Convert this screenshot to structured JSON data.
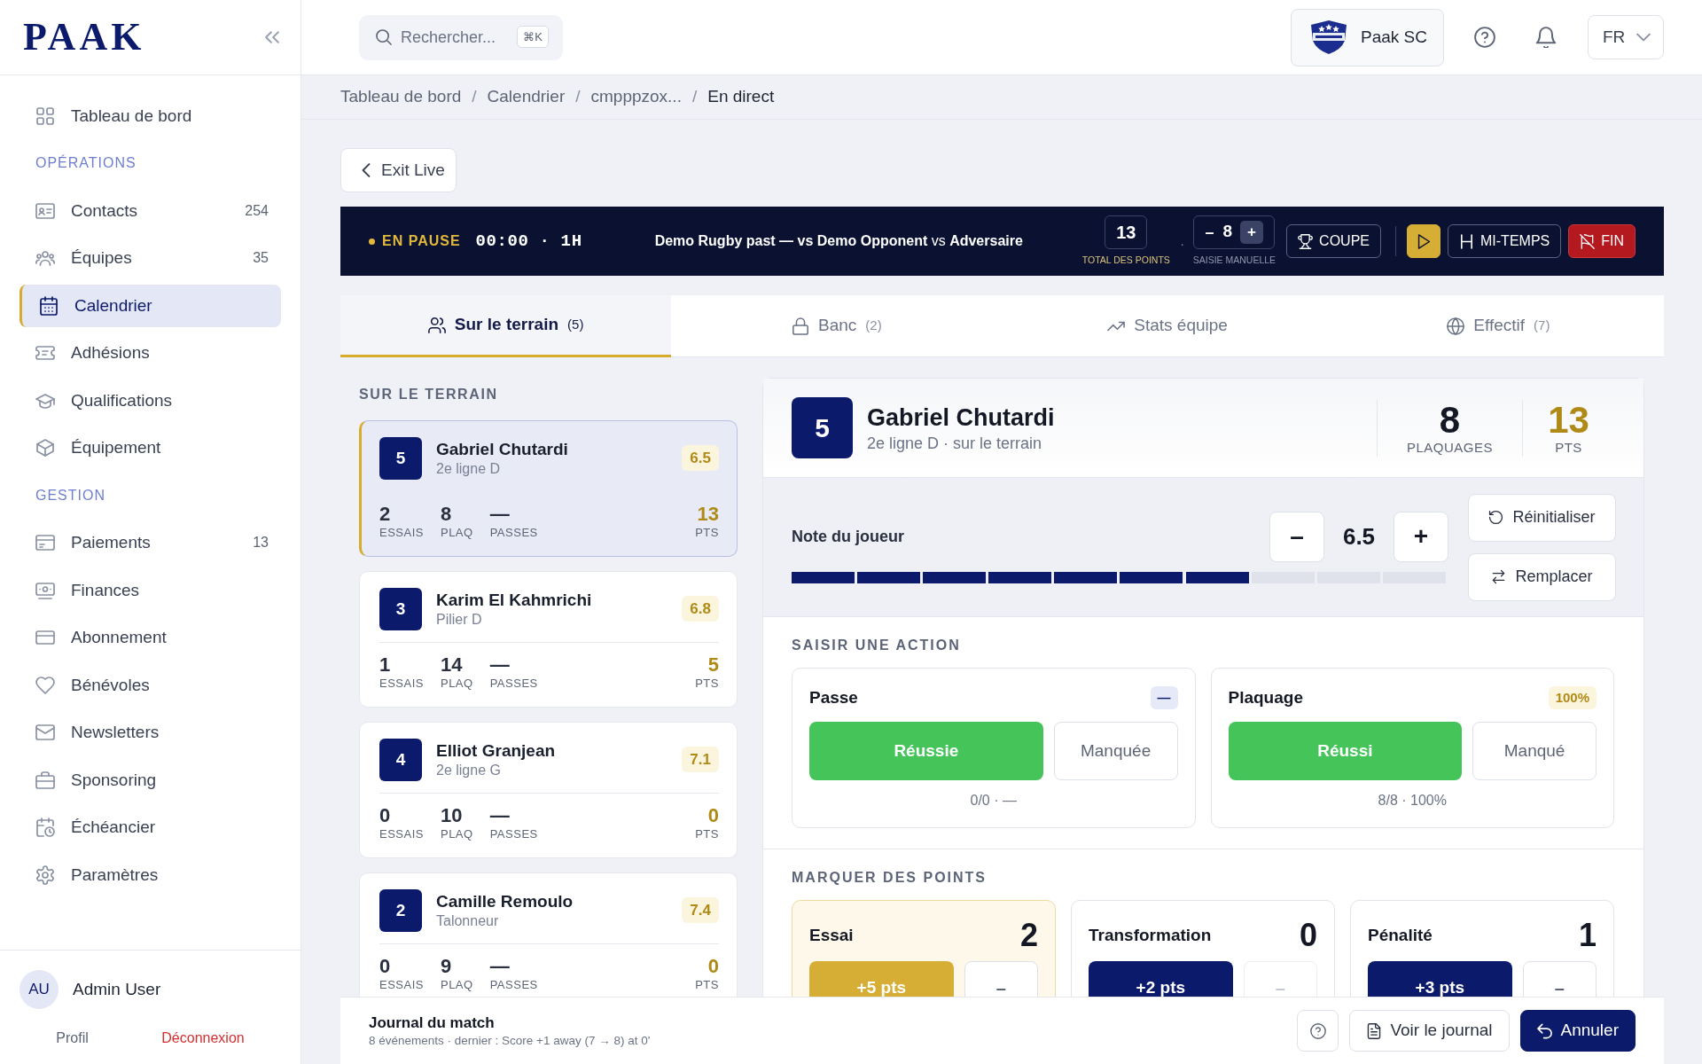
{
  "sidebar": {
    "logo": "PAAK",
    "home": {
      "label": "Tableau de bord",
      "selected": false
    },
    "sections": [
      {
        "title": "OPÉRATIONS",
        "items": [
          {
            "label": "Contacts",
            "count": "254",
            "selected": false
          },
          {
            "label": "Équipes",
            "count": "35",
            "selected": false
          },
          {
            "label": "Calendrier",
            "selected": true
          },
          {
            "label": "Adhésions",
            "selected": false
          },
          {
            "label": "Qualifications",
            "selected": false
          },
          {
            "label": "Équipement",
            "selected": false
          }
        ]
      },
      {
        "title": "GESTION",
        "items": [
          {
            "label": "Paiements",
            "count": "13",
            "selected": false
          },
          {
            "label": "Finances",
            "selected": false
          },
          {
            "label": "Abonnement",
            "selected": false
          },
          {
            "label": "Bénévoles",
            "selected": false
          },
          {
            "label": "Newsletters",
            "selected": false
          },
          {
            "label": "Sponsoring",
            "selected": false
          },
          {
            "label": "Échéancier",
            "selected": false
          },
          {
            "label": "Paramètres",
            "selected": false
          }
        ]
      }
    ],
    "user": {
      "initials": "AU",
      "name": "Admin User",
      "links": [
        {
          "label": "Profil",
          "kind": "plain"
        },
        {
          "label": "Déconnexion",
          "kind": "danger"
        }
      ]
    }
  },
  "topbar": {
    "search": {
      "placeholder": "Rechercher...",
      "shortcut": "⌘K"
    },
    "club": "Paak SC",
    "language": "FR"
  },
  "breadcrumb": [
    {
      "kind": "link",
      "label": "Tableau de bord"
    },
    {
      "kind": "separator",
      "label": "/"
    },
    {
      "kind": "link",
      "label": "Calendrier"
    },
    {
      "kind": "separator",
      "label": "/"
    },
    {
      "kind": "link",
      "label": "cmpppzox..."
    },
    {
      "kind": "separator",
      "label": "/"
    },
    {
      "kind": "current",
      "label": "En direct"
    }
  ],
  "exit_button": "Exit Live",
  "scoreboard": {
    "status": "EN PAUSE",
    "clock": "00:00 · 1H",
    "match": "**Demo Rugby past — vs Demo Opponent** vs **Adversaire**",
    "total": {
      "value": "13",
      "label": "TOTAL DES POINTS"
    },
    "separator": ".",
    "manual": {
      "minus": "–",
      "value": "8",
      "plus": "+",
      "label": "SAISIE MANUELLE"
    },
    "buttons": [
      {
        "kind": "cup",
        "label": "COUPE"
      },
      {
        "kind": "play"
      },
      {
        "kind": "halftime",
        "label": "MI-TEMPS"
      },
      {
        "kind": "end",
        "label": "FIN"
      }
    ]
  },
  "tabs": [
    {
      "label": "Sur le terrain",
      "count": "(5)",
      "selected": true
    },
    {
      "label": "Banc",
      "count": "(2)",
      "selected": false
    },
    {
      "label": "Stats équipe",
      "selected": false
    },
    {
      "label": "Effectif",
      "count": "(7)",
      "selected": false
    }
  ],
  "players_panel": {
    "title": "SUR LE TERRAIN",
    "players": [
      {
        "number": "5",
        "name": "Gabriel Chutardi",
        "position": "2e ligne D",
        "rating": "6.5",
        "selected": true,
        "stats": [
          {
            "value": "2",
            "label": "ESSAIS"
          },
          {
            "value": "8",
            "label": "PLAQ"
          },
          {
            "value": "—",
            "label": "PASSES"
          }
        ],
        "points": {
          "value": "13",
          "label": "PTS"
        }
      },
      {
        "number": "3",
        "name": "Karim El Kahmrichi",
        "position": "Pilier D",
        "rating": "6.8",
        "selected": false,
        "stats": [
          {
            "value": "1",
            "label": "ESSAIS"
          },
          {
            "value": "14",
            "label": "PLAQ"
          },
          {
            "value": "—",
            "label": "PASSES"
          }
        ],
        "points": {
          "value": "5",
          "label": "PTS"
        }
      },
      {
        "number": "4",
        "name": "Elliot Granjean",
        "position": "2e ligne G",
        "rating": "7.1",
        "selected": false,
        "stats": [
          {
            "value": "0",
            "label": "ESSAIS"
          },
          {
            "value": "10",
            "label": "PLAQ"
          },
          {
            "value": "—",
            "label": "PASSES"
          }
        ],
        "points": {
          "value": "0",
          "label": "PTS"
        }
      },
      {
        "number": "2",
        "name": "Camille Remoulo",
        "position": "Talonneur",
        "rating": "7.4",
        "selected": false,
        "stats": [
          {
            "value": "0",
            "label": "ESSAIS"
          },
          {
            "value": "9",
            "label": "PLAQ"
          },
          {
            "value": "—",
            "label": "PASSES"
          }
        ],
        "points": {
          "value": "0",
          "label": "PTS"
        }
      }
    ]
  },
  "player_detail": {
    "number": "5",
    "name": "Gabriel Chutardi",
    "subtitle": "2e ligne D · sur le terrain",
    "stats": [
      {
        "value": "8",
        "label": "PLAQUAGES",
        "kind": "plain"
      },
      {
        "value": "13",
        "label": "PTS",
        "kind": "gold"
      }
    ],
    "rating": {
      "label": "Note du joueur",
      "minus": "–",
      "value": "6.5",
      "plus": "+",
      "level": 0.7
    },
    "buttons": [
      {
        "kind": "reset",
        "label": "Réinitialiser"
      },
      {
        "kind": "swap",
        "label": "Remplacer"
      }
    ]
  },
  "actions": {
    "title": "SAISIR UNE ACTION",
    "cards": [
      {
        "kind": "neutral",
        "title": "Passe",
        "badge": "—",
        "success": "Réussie",
        "fail": "Manquée",
        "summary": "0/0 · —"
      },
      {
        "kind": "gold",
        "title": "Plaquage",
        "badge": "100%",
        "success": "Réussi",
        "fail": "Manqué",
        "summary": "8/8 · 100%"
      }
    ]
  },
  "scoring": {
    "title": "MARQUER DES POINTS",
    "cards": [
      {
        "title": "Essai",
        "count": "2",
        "add": "+5 pts",
        "remove": "–",
        "highlighted": true,
        "remove_disabled": false
      },
      {
        "title": "Transformation",
        "count": "0",
        "add": "+2 pts",
        "remove": "–",
        "highlighted": false,
        "remove_disabled": true
      },
      {
        "title": "Pénalité",
        "count": "1",
        "add": "+3 pts",
        "remove": "–",
        "highlighted": false,
        "remove_disabled": false
      }
    ]
  },
  "journal": {
    "title": "Journal du match",
    "summary": "8 événements · dernier : Score +1 away (7 → 8) at 0'",
    "buttons": [
      {
        "kind": "help"
      },
      {
        "kind": "log",
        "label": "Voir le journal"
      },
      {
        "kind": "undo",
        "label": "Annuler"
      }
    ]
  }
}
